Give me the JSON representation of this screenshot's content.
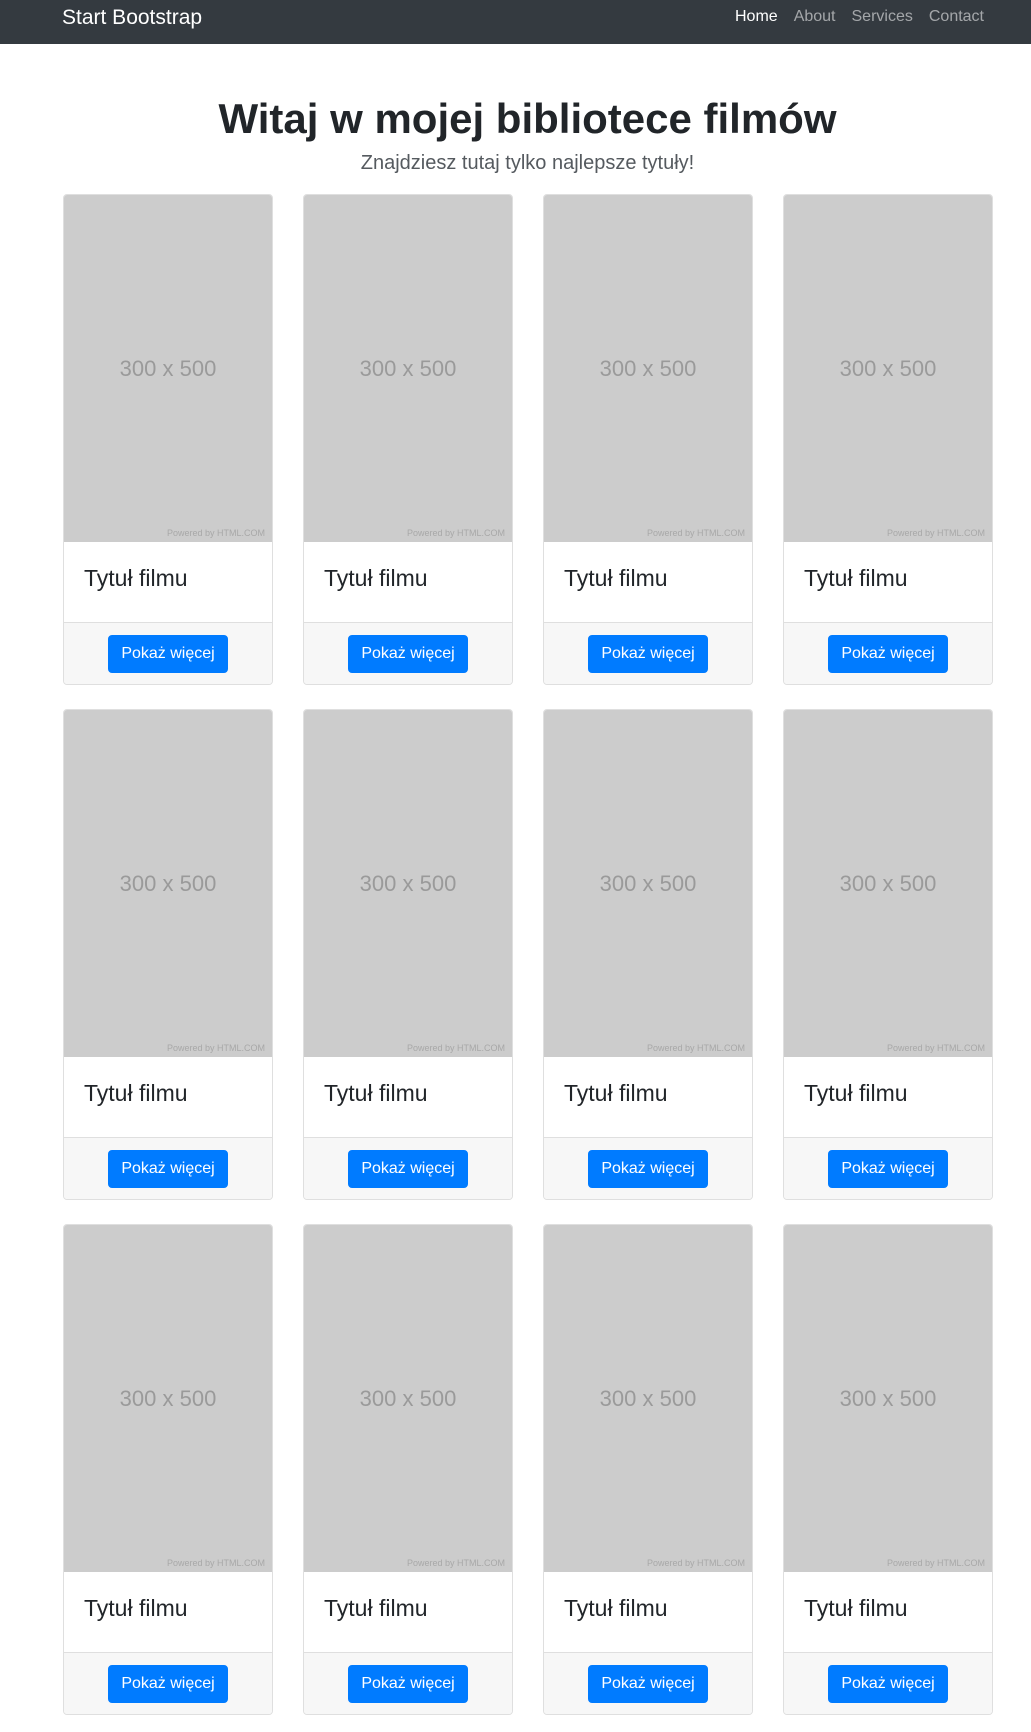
{
  "navbar": {
    "brand": "Start Bootstrap",
    "links": [
      {
        "label": "Home",
        "active": true
      },
      {
        "label": "About",
        "active": false
      },
      {
        "label": "Services",
        "active": false
      },
      {
        "label": "Contact",
        "active": false
      }
    ]
  },
  "hero": {
    "title": "Witaj w mojej bibliotece filmów",
    "subtitle": "Znajdziesz tutaj tylko najlepsze tytuły!"
  },
  "placeholder": {
    "label": "300 x 500",
    "credit": "Powered by HTML.COM"
  },
  "cards": [
    {
      "title": "Tytuł filmu",
      "button": "Pokaż więcej"
    },
    {
      "title": "Tytuł filmu",
      "button": "Pokaż więcej"
    },
    {
      "title": "Tytuł filmu",
      "button": "Pokaż więcej"
    },
    {
      "title": "Tytuł filmu",
      "button": "Pokaż więcej"
    },
    {
      "title": "Tytuł filmu",
      "button": "Pokaż więcej"
    },
    {
      "title": "Tytuł filmu",
      "button": "Pokaż więcej"
    },
    {
      "title": "Tytuł filmu",
      "button": "Pokaż więcej"
    },
    {
      "title": "Tytuł filmu",
      "button": "Pokaż więcej"
    },
    {
      "title": "Tytuł filmu",
      "button": "Pokaż więcej"
    },
    {
      "title": "Tytuł filmu",
      "button": "Pokaż więcej"
    },
    {
      "title": "Tytuł filmu",
      "button": "Pokaż więcej"
    },
    {
      "title": "Tytuł filmu",
      "button": "Pokaż więcej"
    }
  ],
  "colors": {
    "navbar_bg": "#343a40",
    "button_primary": "#007bff",
    "placeholder_bg": "#cccccc"
  }
}
